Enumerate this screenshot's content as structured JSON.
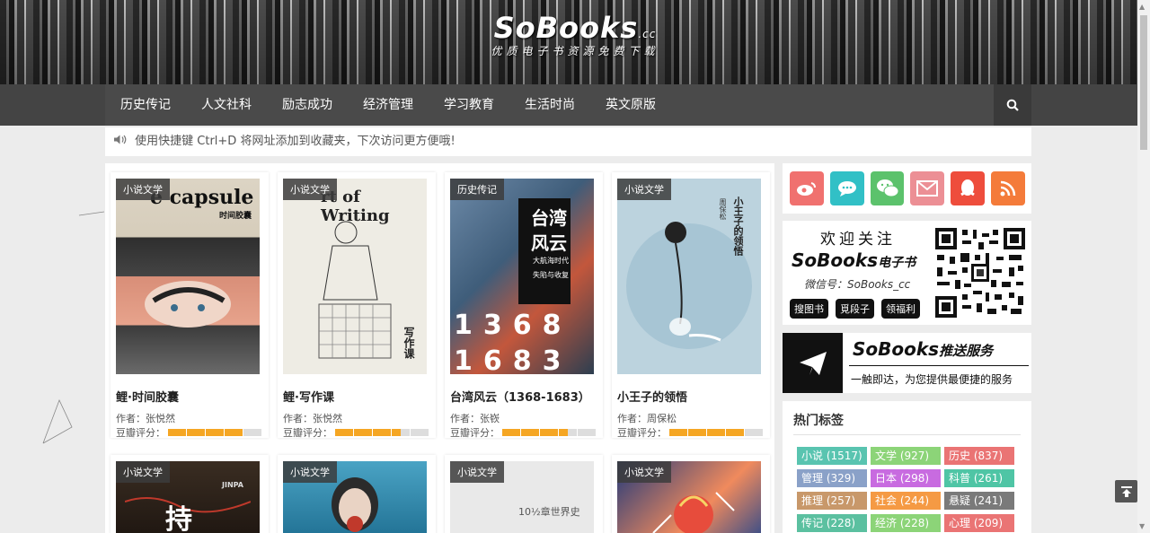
{
  "site": {
    "logo": "SoBooks",
    "logo_suffix": ".cc",
    "slogan": "优质电子书资源免费下载"
  },
  "nav": {
    "items": [
      "历史传记",
      "人文社科",
      "励志成功",
      "经济管理",
      "学习教育",
      "生活时尚",
      "英文原版"
    ],
    "search_icon": "search-icon"
  },
  "notice": {
    "text": "使用快捷键 Ctrl+D 将网址添加到收藏夹，下次访问更方便哦!"
  },
  "books": [
    {
      "tag": "小说文学",
      "title": "鲤·时间胶囊",
      "author": "作者：张悦然",
      "rating_label": "豆瓣评分：",
      "rating": 4,
      "cover_text": [
        "e capsule",
        "时间胶囊"
      ]
    },
    {
      "tag": "小说文学",
      "title": "鲤·写作课",
      "author": "作者：张悦然",
      "rating_label": "豆瓣评分：",
      "rating": 3.5,
      "cover_text": [
        "rt of Writing",
        "写作课"
      ]
    },
    {
      "tag": "历史传记",
      "title": "台湾风云（1368-1683）",
      "author": "作者：张嵚",
      "rating_label": "豆瓣评分：",
      "rating": 3.5,
      "cover_text": [
        "台湾",
        "风云",
        "大航海时代",
        "失陷与收复",
        "1368",
        "1683"
      ]
    },
    {
      "tag": "小说文学",
      "title": "小王子的领悟",
      "author": "作者：周保松",
      "rating_label": "豆瓣评分：",
      "rating": 4,
      "cover_text": [
        "小王子的领悟",
        "周保松"
      ]
    },
    {
      "tag": "小说文学",
      "cover_text": [
        "JINPA"
      ]
    },
    {
      "tag": "小说文学"
    },
    {
      "tag": "小说文学",
      "cover_text": [
        "10½章世界史"
      ]
    },
    {
      "tag": "小说文学"
    }
  ],
  "sidebar": {
    "social": [
      {
        "icon": "weibo-icon",
        "color": "#f0716f"
      },
      {
        "icon": "chat-icon",
        "color": "#31c0c6"
      },
      {
        "icon": "wechat-icon",
        "color": "#5cc26c"
      },
      {
        "icon": "mail-icon",
        "color": "#ec8f95"
      },
      {
        "icon": "qq-icon",
        "color": "#ee4d3c"
      },
      {
        "icon": "rss-icon",
        "color": "#f47b3a"
      }
    ],
    "wechat": {
      "title": "欢迎关注",
      "brand": "SoBooks",
      "brand_suffix": "电子书",
      "id_text": "微信号：SoBooks_cc",
      "buttons": [
        "搜图书",
        "覓段子",
        "领福利"
      ]
    },
    "push": {
      "brand": "SoBooks",
      "brand_suffix": "推送服务",
      "text": "一触即达，为您提供最便捷的服务"
    },
    "hot_tags": {
      "title": "热门标签",
      "items": [
        {
          "label": "小说 (1517)",
          "color": "#59c4b0"
        },
        {
          "label": "文学 (927)",
          "color": "#8cd478"
        },
        {
          "label": "历史 (837)",
          "color": "#ea7474"
        },
        {
          "label": "管理 (329)",
          "color": "#8aa1c8"
        },
        {
          "label": "日本 (298)",
          "color": "#c86be0"
        },
        {
          "label": "科普 (261)",
          "color": "#4fc5a5"
        },
        {
          "label": "推理 (257)",
          "color": "#c8986a"
        },
        {
          "label": "社会 (244)",
          "color": "#f59a44"
        },
        {
          "label": "悬疑 (241)",
          "color": "#7a7a7a"
        },
        {
          "label": "传记 (228)",
          "color": "#5bc0a0"
        },
        {
          "label": "经济 (228)",
          "color": "#8cd478"
        },
        {
          "label": "心理 (209)",
          "color": "#ea7474"
        }
      ]
    }
  }
}
